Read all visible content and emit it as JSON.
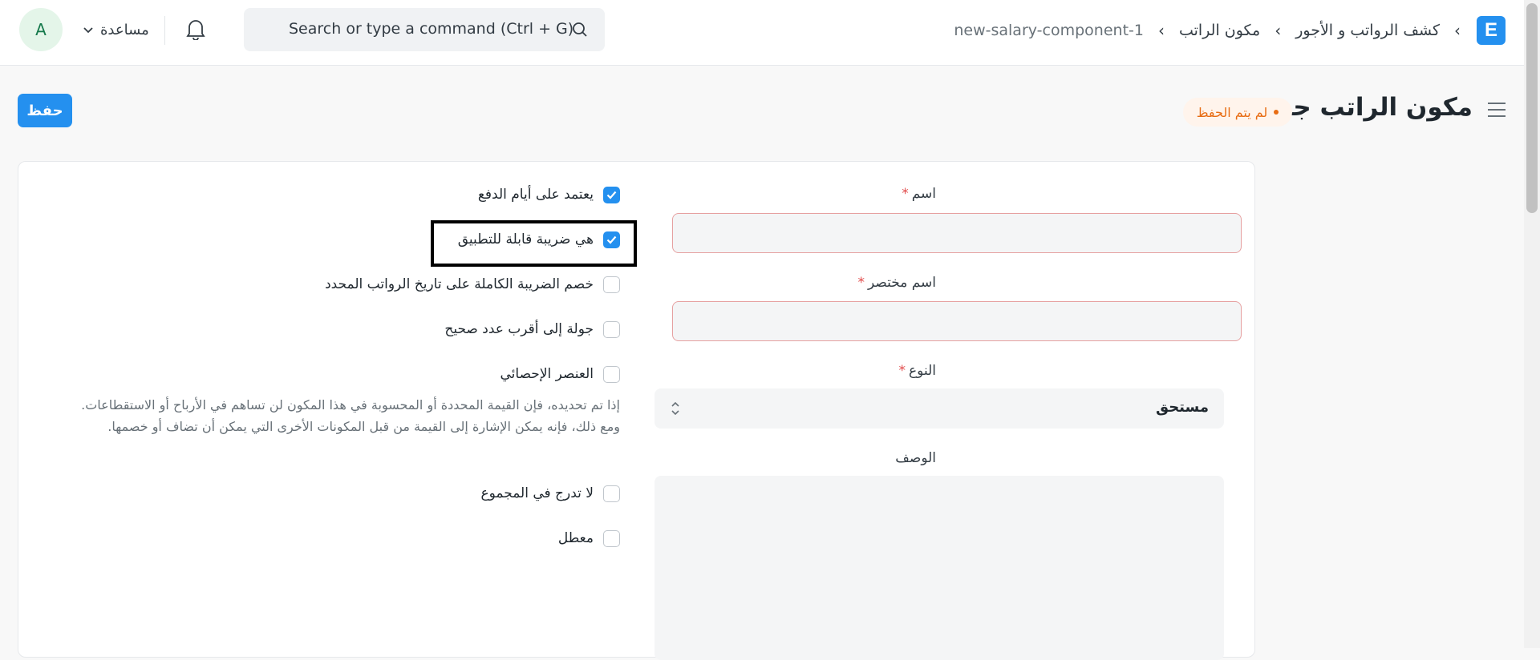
{
  "navbar": {
    "logo_letter": "E",
    "breadcrumbs": [
      "كشف الرواتب و الأجور",
      "مكون الراتب",
      "new-salary-component-1"
    ],
    "breadcrumb_separator": "›",
    "search_placeholder": "Search or type a command (Ctrl + G)",
    "help_label": "مساعدة",
    "avatar_letter": "A"
  },
  "page": {
    "title": "مكون الراتب جديد",
    "status": "لم يتم الحفظ",
    "save_label": "حفظ"
  },
  "form": {
    "name": {
      "label": "اسم",
      "required_mark": "*",
      "value": ""
    },
    "abbr": {
      "label": "اسم مختصر",
      "required_mark": "*",
      "value": ""
    },
    "type": {
      "label": "النوع",
      "required_mark": "*",
      "value": "مستحق"
    },
    "description": {
      "label": "الوصف",
      "value": ""
    },
    "checkboxes": [
      {
        "label": "يعتمد على أيام الدفع",
        "checked": true
      },
      {
        "label": "هي ضريبة قابلة للتطبيق",
        "checked": true
      },
      {
        "label": "خصم الضريبة الكاملة على تاريخ الرواتب المحدد",
        "checked": false
      },
      {
        "label": "جولة إلى أقرب عدد صحيح",
        "checked": false
      },
      {
        "label": "العنصر الإحصائي",
        "checked": false
      },
      {
        "label": "لا تدرج في المجموع",
        "checked": false
      },
      {
        "label": "معطل",
        "checked": false
      }
    ],
    "statistical_description": "إذا تم تحديده، فإن القيمة المحددة أو المحسوبة في هذا المكون لن تساهم في الأرباح أو الاستقطاعات. ومع ذلك، فإنه يمكن الإشارة إلى القيمة من قبل المكونات الأخرى التي يمكن أن تضاف أو خصمها."
  },
  "colors": {
    "primary": "#2490ef",
    "status": "#e86c13",
    "required": "#e24c4c",
    "highlight": "#000000"
  },
  "icons": [
    "menu-icon",
    "search-icon",
    "bell-icon",
    "chevron-down-icon",
    "check-icon",
    "select-arrows-icon"
  ]
}
